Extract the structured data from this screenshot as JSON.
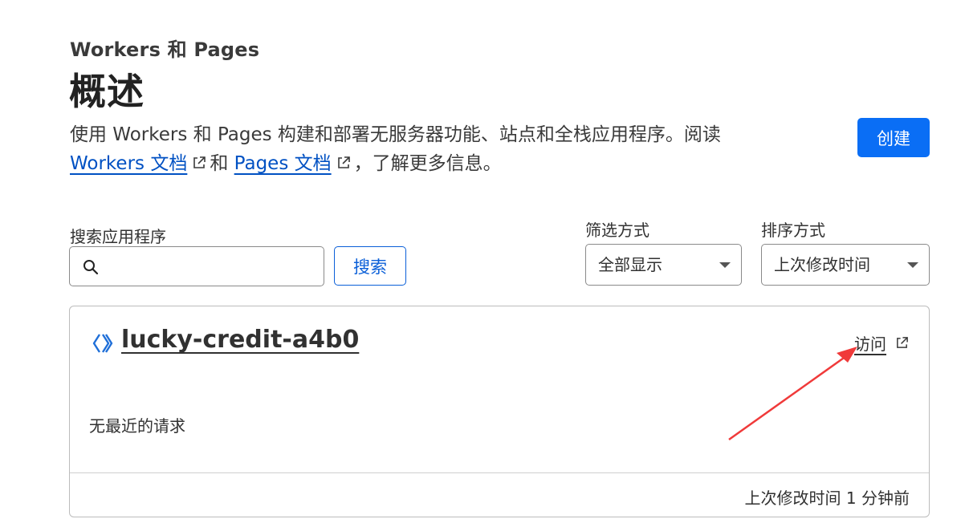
{
  "header": {
    "breadcrumb": "Workers 和 Pages",
    "title": "概述"
  },
  "description": {
    "text_before": "使用 Workers 和 Pages 构建和部署无服务器功能、站点和全栈应用程序。阅读 ",
    "workers_docs_link": "Workers 文档",
    "conjunction": "和",
    "pages_docs_link": "Pages 文档",
    "text_after": "，了解更多信息。"
  },
  "create_button": "创建",
  "search": {
    "label": "搜索应用程序",
    "value": "",
    "placeholder": "",
    "button": "搜索"
  },
  "filter": {
    "label": "筛选方式",
    "selected": "全部显示"
  },
  "sort": {
    "label": "排序方式",
    "selected": "上次修改时间"
  },
  "worker_card": {
    "name": "lucky-credit-a4b0",
    "visit_label": "访问",
    "requests_status": "无最近的请求",
    "last_modified": "上次修改时间 1 分钟前"
  },
  "colors": {
    "accent_blue": "#0a6ef5",
    "link_blue": "#0051c3",
    "annotation_arrow": "#f03a3a"
  }
}
